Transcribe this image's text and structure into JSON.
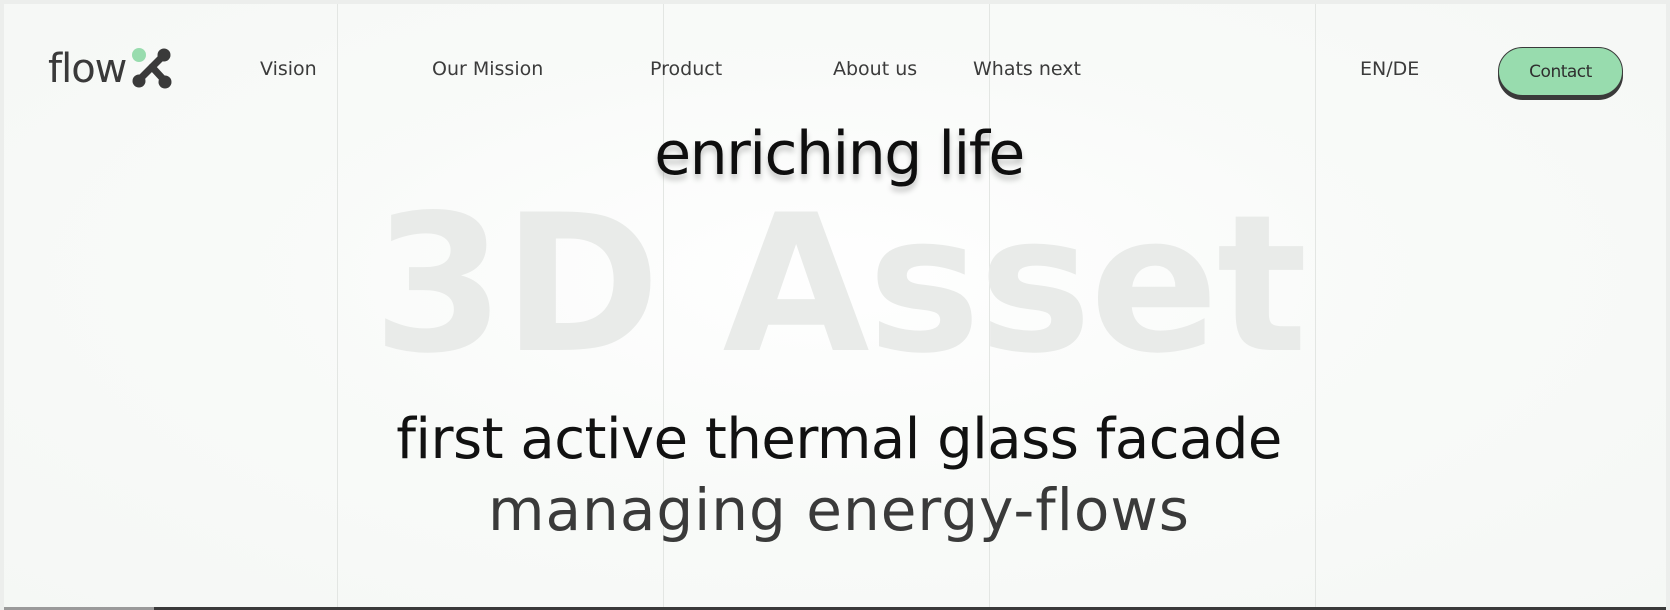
{
  "header": {
    "logo_text": "flow",
    "nav": {
      "vision": "Vision",
      "mission": "Our Mission",
      "product": "Product",
      "about": "About us",
      "next": "Whats next",
      "lang": "EN/DE"
    },
    "contact_label": "Contact"
  },
  "hero": {
    "tagline": "enriching life",
    "watermark": "3D Asset",
    "headline": "first active thermal glass facade",
    "subline": "managing energy-flows"
  },
  "colors": {
    "accent": "#98dcae",
    "text": "#3b3b3b",
    "watermark": "#e9ebe9"
  }
}
